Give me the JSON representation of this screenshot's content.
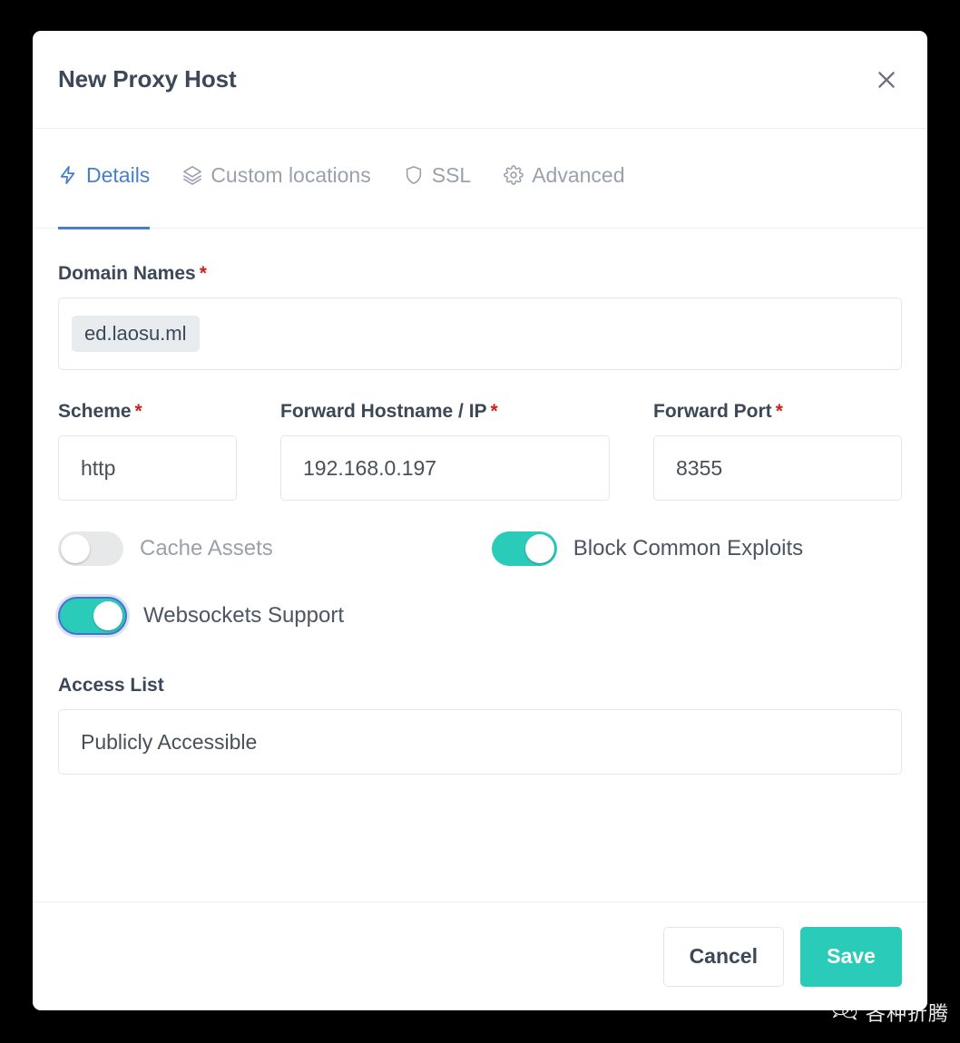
{
  "modal": {
    "title": "New Proxy Host",
    "close_icon": "close-icon"
  },
  "tabs": [
    {
      "label": "Details",
      "icon": "zap-icon",
      "active": true
    },
    {
      "label": "Custom locations",
      "icon": "layers-icon",
      "active": false
    },
    {
      "label": "SSL",
      "icon": "shield-icon",
      "active": false
    },
    {
      "label": "Advanced",
      "icon": "gear-icon",
      "active": false
    }
  ],
  "form": {
    "domain_names": {
      "label": "Domain Names",
      "required_marker": "*",
      "tags": [
        "ed.laosu.ml"
      ]
    },
    "scheme": {
      "label": "Scheme",
      "required_marker": "*",
      "value": "http"
    },
    "forward_hostname": {
      "label": "Forward Hostname / IP",
      "required_marker": "*",
      "value": "192.168.0.197"
    },
    "forward_port": {
      "label": "Forward Port",
      "required_marker": "*",
      "value": "8355"
    },
    "toggles": {
      "cache_assets": {
        "label": "Cache Assets",
        "on": false,
        "focused": false
      },
      "block_common_exploits": {
        "label": "Block Common Exploits",
        "on": true,
        "focused": false
      },
      "websockets_support": {
        "label": "Websockets Support",
        "on": true,
        "focused": true
      }
    },
    "access_list": {
      "label": "Access List",
      "value": "Publicly Accessible"
    }
  },
  "footer": {
    "cancel_label": "Cancel",
    "save_label": "Save"
  },
  "watermark": {
    "text": "各种折腾",
    "icon": "wechat-icon"
  },
  "colors": {
    "accent_teal": "#2bcbba",
    "accent_blue": "#467fcf",
    "required_red": "#cd201f",
    "text_dark": "#3c4858",
    "text_muted": "#9aa0ac",
    "border": "#e3e7ed",
    "page_background": "#000000",
    "modal_background": "#ffffff",
    "tag_background": "#e9ecef"
  }
}
